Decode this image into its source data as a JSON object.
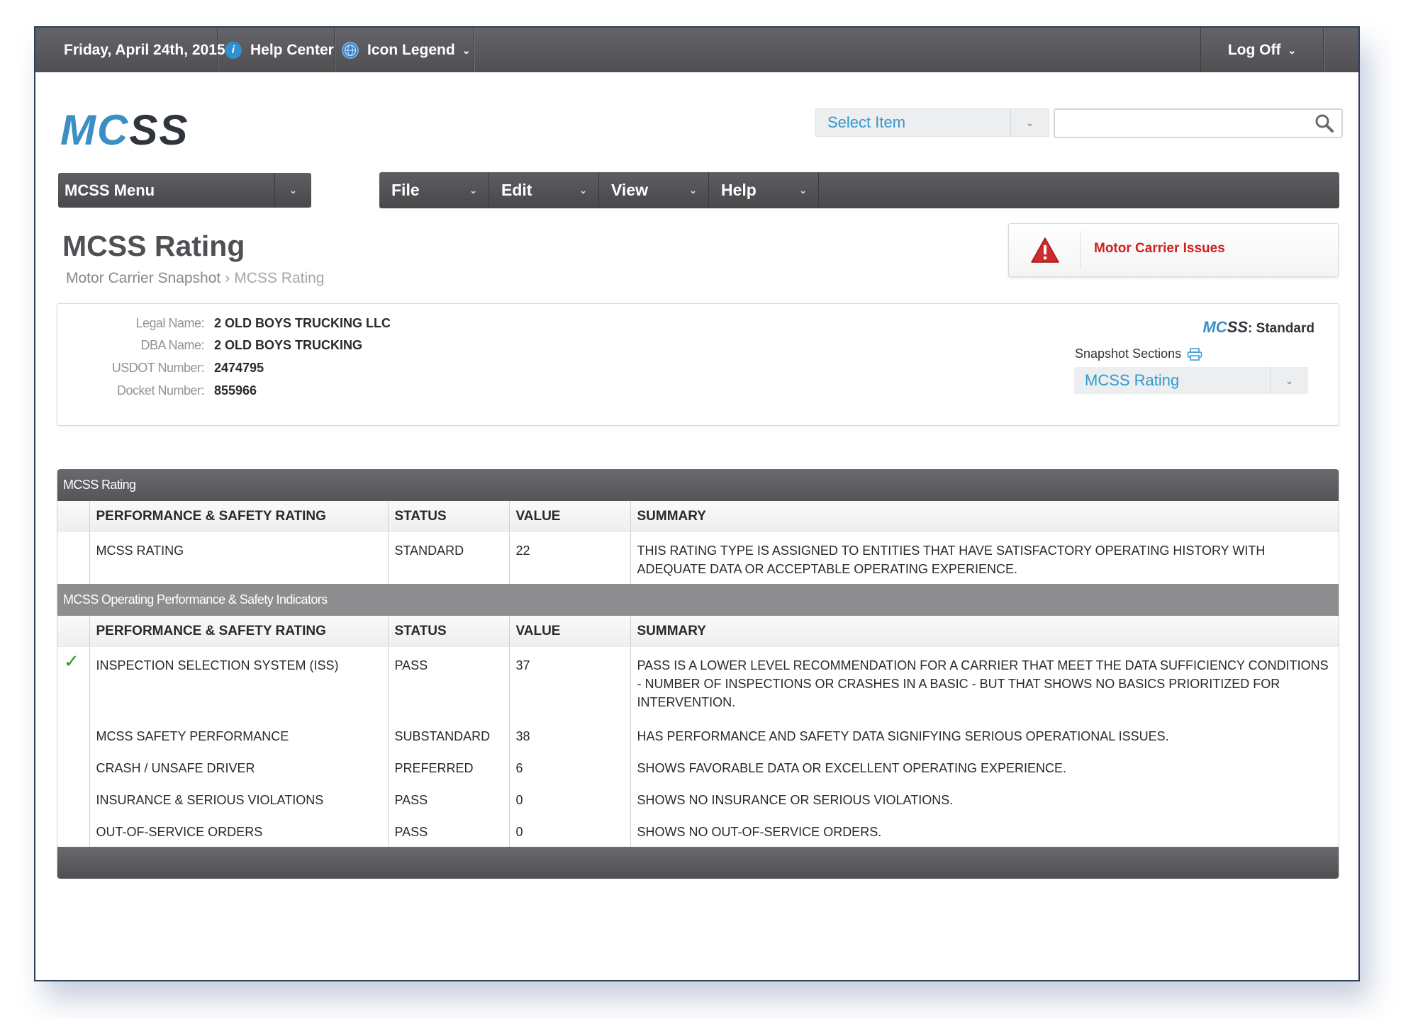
{
  "topbar": {
    "date": "Friday, April 24th, 2015",
    "help_center": "Help Center",
    "icon_legend": "Icon Legend",
    "log_off": "Log Off"
  },
  "logo": {
    "part1": "MC",
    "part2": "SS"
  },
  "search": {
    "select_label": "Select Item",
    "query": ""
  },
  "menus": {
    "mcss_menu": "MCSS Menu",
    "items": [
      "File",
      "Edit",
      "View",
      "Help"
    ]
  },
  "page": {
    "title": "MCSS Rating",
    "breadcrumb": [
      "Motor Carrier Snapshot",
      "MCSS Rating"
    ],
    "breadcrumb_sep": "›",
    "issues_label": "Motor Carrier Issues"
  },
  "carrier": {
    "fields": [
      {
        "label": "Legal Name:",
        "value": "2 OLD BOYS TRUCKING LLC"
      },
      {
        "label": "DBA Name:",
        "value": "2 OLD BOYS TRUCKING"
      },
      {
        "label": "USDOT Number:",
        "value": "2474795"
      },
      {
        "label": "Docket Number:",
        "value": "855966"
      }
    ],
    "badge_logo1": "MC",
    "badge_logo2": "SS",
    "badge_text": ": Standard",
    "snapshot_label": "Snapshot Sections",
    "snapshot_value": "MCSS Rating"
  },
  "rating_table": {
    "section_title": "MCSS Rating",
    "headers": [
      "PERFORMANCE & SAFETY RATING",
      "STATUS",
      "VALUE",
      "SUMMARY"
    ],
    "rows": [
      {
        "check": "",
        "rating": "MCSS RATING",
        "status": "STANDARD",
        "value": "22",
        "summary": "THIS RATING TYPE IS ASSIGNED TO ENTITIES THAT HAVE SATISFACTORY OPERATING HISTORY WITH ADEQUATE DATA OR ACCEPTABLE OPERATING EXPERIENCE."
      }
    ]
  },
  "indicators_table": {
    "section_title": "MCSS Operating Performance & Safety Indicators",
    "headers": [
      "PERFORMANCE & SAFETY RATING",
      "STATUS",
      "VALUE",
      "SUMMARY"
    ],
    "rows": [
      {
        "check": "✓",
        "rating": "INSPECTION SELECTION SYSTEM (ISS)",
        "status": "PASS",
        "value": "37",
        "summary": "PASS IS A LOWER LEVEL RECOMMENDATION FOR A CARRIER THAT MEET THE DATA SUFFICIENCY CONDITIONS - NUMBER OF INSPECTIONS OR CRASHES IN A BASIC - BUT THAT SHOWS NO BASICS PRIORITIZED FOR INTERVENTION."
      },
      {
        "check": "",
        "rating": "MCSS SAFETY PERFORMANCE",
        "status": "SUBSTANDARD",
        "value": "38",
        "summary": "HAS PERFORMANCE AND SAFETY DATA SIGNIFYING SERIOUS OPERATIONAL ISSUES."
      },
      {
        "check": "",
        "rating": "CRASH / UNSAFE DRIVER",
        "status": "PREFERRED",
        "value": "6",
        "summary": "SHOWS FAVORABLE DATA OR EXCELLENT OPERATING EXPERIENCE."
      },
      {
        "check": "",
        "rating": "INSURANCE & SERIOUS VIOLATIONS",
        "status": "PASS",
        "value": "0",
        "summary": "SHOWS NO INSURANCE OR SERIOUS VIOLATIONS."
      },
      {
        "check": "",
        "rating": "OUT-OF-SERVICE ORDERS",
        "status": "PASS",
        "value": "0",
        "summary": "SHOWS NO OUT-OF-SERVICE ORDERS."
      }
    ]
  },
  "colors": {
    "accent": "#2f9ad0",
    "warning": "#cc2121",
    "check": "#2b9b2b",
    "bar": "#5b5b5f"
  },
  "icons": {
    "help": "info-icon",
    "legend": "globe-icon",
    "search": "search-icon",
    "warning": "warning-icon",
    "print": "print-icon",
    "check": "checkmark-icon"
  }
}
